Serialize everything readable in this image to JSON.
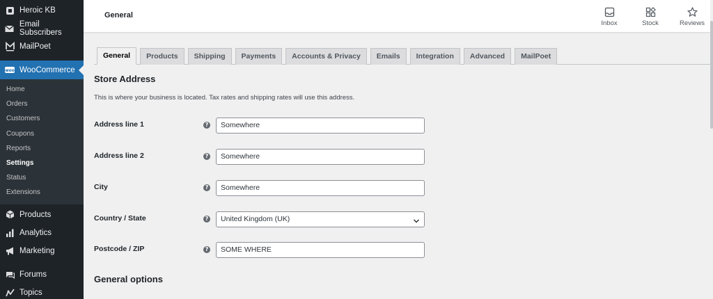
{
  "sidebar": {
    "top_items": [
      {
        "label": "Heroic KB",
        "icon": "square-icon"
      },
      {
        "label": "Email Subscribers",
        "icon": "envelope-icon"
      },
      {
        "label": "MailPoet",
        "icon": "mailpoet-icon"
      }
    ],
    "woocommerce": {
      "label": "WooCommerce",
      "badge": "woo"
    },
    "submenu": [
      {
        "label": "Home",
        "current": false
      },
      {
        "label": "Orders",
        "current": false
      },
      {
        "label": "Customers",
        "current": false
      },
      {
        "label": "Coupons",
        "current": false
      },
      {
        "label": "Reports",
        "current": false
      },
      {
        "label": "Settings",
        "current": true
      },
      {
        "label": "Status",
        "current": false
      },
      {
        "label": "Extensions",
        "current": false
      }
    ],
    "bottom_items": [
      {
        "label": "Products",
        "icon": "box-icon"
      },
      {
        "label": "Analytics",
        "icon": "bar-chart-icon"
      },
      {
        "label": "Marketing",
        "icon": "megaphone-icon"
      },
      {
        "label": "Forums",
        "icon": "forums-icon"
      },
      {
        "label": "Topics",
        "icon": "topics-icon"
      }
    ]
  },
  "header": {
    "title": "General",
    "actions": [
      {
        "label": "Inbox",
        "icon": "inbox-icon"
      },
      {
        "label": "Stock",
        "icon": "stock-icon"
      },
      {
        "label": "Reviews",
        "icon": "star-icon"
      }
    ]
  },
  "tabs": [
    {
      "label": "General",
      "active": true
    },
    {
      "label": "Products",
      "active": false
    },
    {
      "label": "Shipping",
      "active": false
    },
    {
      "label": "Payments",
      "active": false
    },
    {
      "label": "Accounts & Privacy",
      "active": false
    },
    {
      "label": "Emails",
      "active": false
    },
    {
      "label": "Integration",
      "active": false
    },
    {
      "label": "Advanced",
      "active": false
    },
    {
      "label": "MailPoet",
      "active": false
    }
  ],
  "store_address": {
    "title": "Store Address",
    "description": "This is where your business is located. Tax rates and shipping rates will use this address.",
    "fields": [
      {
        "label": "Address line 1",
        "value": "Somewhere"
      },
      {
        "label": "Address line 2",
        "value": "Somewhere"
      },
      {
        "label": "City",
        "value": "Somewhere"
      },
      {
        "label": "Country / State",
        "value": "United Kingdom (UK)"
      },
      {
        "label": "Postcode / ZIP",
        "value": "SOME WHERE"
      }
    ]
  },
  "general_options": {
    "title": "General options"
  },
  "colors": {
    "sidebar_bg": "#1d2327",
    "accent": "#2271b1",
    "content_bg": "#f0f0f1"
  }
}
